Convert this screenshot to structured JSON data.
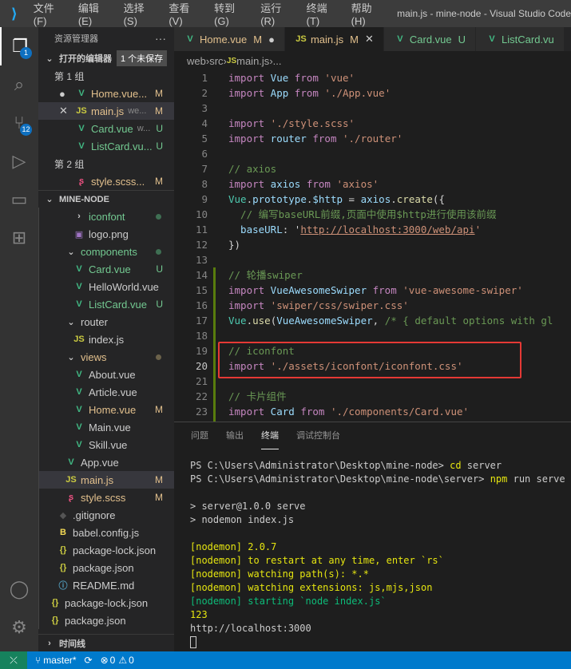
{
  "window": {
    "title": "main.js - mine-node - Visual Studio Code",
    "menu": [
      "文件(F)",
      "编辑(E)",
      "选择(S)",
      "查看(V)",
      "转到(G)",
      "运行(R)",
      "终端(T)",
      "帮助(H)"
    ]
  },
  "activity": [
    {
      "icon": "files-icon",
      "glyph": "❐",
      "badge": "1",
      "active": true
    },
    {
      "icon": "search-icon",
      "glyph": "⌕"
    },
    {
      "icon": "source-control-icon",
      "glyph": "⑂",
      "badge": "12"
    },
    {
      "icon": "run-debug-icon",
      "glyph": "▷"
    },
    {
      "icon": "remote-explorer-icon",
      "glyph": "▭"
    },
    {
      "icon": "extensions-icon",
      "glyph": "⊞"
    }
  ],
  "activity_bottom": [
    {
      "icon": "account-icon",
      "glyph": "◯"
    },
    {
      "icon": "settings-gear-icon",
      "glyph": "⚙"
    }
  ],
  "sidebar": {
    "title": "资源管理器",
    "more": "···",
    "open_editors": "打开的编辑器",
    "unsaved": "1 个未保存",
    "project": "MINE-NODE",
    "timeline": "时间线",
    "open_items": [
      {
        "type": "group",
        "label": "第 1 组"
      },
      {
        "label": "Home.vue...",
        "icon": "vue",
        "color": "#e2c08d",
        "status": "M",
        "lead": "●"
      },
      {
        "label": "main.js",
        "desc": "we...",
        "icon": "js",
        "color": "#e2c08d",
        "status": "M",
        "lead": "✕",
        "sel": true
      },
      {
        "label": "Card.vue",
        "desc": "w...",
        "icon": "vue",
        "color": "#73c991",
        "status": "U"
      },
      {
        "label": "ListCard.vu...",
        "icon": "vue",
        "color": "#73c991",
        "status": "U"
      },
      {
        "type": "group",
        "label": "第 2 组"
      },
      {
        "label": "style.scss...",
        "icon": "scss",
        "color": "#e2c08d",
        "status": "M"
      }
    ],
    "tree": [
      {
        "label": "iconfont",
        "indent": 3,
        "icon": "chev-r",
        "color": "#73c991",
        "dot": "#3f6f53"
      },
      {
        "label": "logo.png",
        "indent": 3,
        "icon": "img",
        "color": "#ccc"
      },
      {
        "label": "components",
        "indent": 2,
        "icon": "chev-d",
        "color": "#73c991",
        "dot": "#3f6f53"
      },
      {
        "label": "Card.vue",
        "indent": 3,
        "icon": "vue",
        "color": "#73c991",
        "status": "U"
      },
      {
        "label": "HelloWorld.vue",
        "indent": 3,
        "icon": "vue",
        "color": "#ccc"
      },
      {
        "label": "ListCard.vue",
        "indent": 3,
        "icon": "vue",
        "color": "#73c991",
        "status": "U"
      },
      {
        "label": "router",
        "indent": 2,
        "icon": "chev-d",
        "color": "#ccc"
      },
      {
        "label": "index.js",
        "indent": 3,
        "icon": "js",
        "color": "#ccc"
      },
      {
        "label": "views",
        "indent": 2,
        "icon": "chev-d",
        "color": "#e2c08d",
        "dot": "#6b624a"
      },
      {
        "label": "About.vue",
        "indent": 3,
        "icon": "vue",
        "color": "#ccc"
      },
      {
        "label": "Article.vue",
        "indent": 3,
        "icon": "vue",
        "color": "#ccc"
      },
      {
        "label": "Home.vue",
        "indent": 3,
        "icon": "vue",
        "color": "#e2c08d",
        "status": "M"
      },
      {
        "label": "Main.vue",
        "indent": 3,
        "icon": "vue",
        "color": "#ccc"
      },
      {
        "label": "Skill.vue",
        "indent": 3,
        "icon": "vue",
        "color": "#ccc"
      },
      {
        "label": "App.vue",
        "indent": 2,
        "icon": "vue",
        "color": "#ccc"
      },
      {
        "label": "main.js",
        "indent": 2,
        "icon": "js",
        "color": "#e2c08d",
        "status": "M",
        "sel": true
      },
      {
        "label": "style.scss",
        "indent": 2,
        "icon": "scss",
        "color": "#e2c08d",
        "status": "M"
      },
      {
        "label": ".gitignore",
        "indent": 1,
        "icon": "git",
        "color": "#ccc"
      },
      {
        "label": "babel.config.js",
        "indent": 1,
        "icon": "babel",
        "color": "#ccc"
      },
      {
        "label": "package-lock.json",
        "indent": 1,
        "icon": "json",
        "color": "#ccc"
      },
      {
        "label": "package.json",
        "indent": 1,
        "icon": "json",
        "color": "#ccc"
      },
      {
        "label": "README.md",
        "indent": 1,
        "icon": "info",
        "color": "#ccc"
      },
      {
        "label": "package-lock.json",
        "indent": 0,
        "icon": "json",
        "color": "#ccc"
      },
      {
        "label": "package.json",
        "indent": 0,
        "icon": "json",
        "color": "#ccc"
      }
    ]
  },
  "tabs": [
    {
      "label": "Home.vue",
      "status": "M",
      "icon": "vue",
      "color": "#e2c08d",
      "mark": "●"
    },
    {
      "label": "main.js",
      "status": "M",
      "icon": "js",
      "color": "#e2c08d",
      "mark": "✕",
      "active": true
    },
    {
      "label": "Card.vue",
      "status": "U",
      "icon": "vue",
      "color": "#73c991"
    },
    {
      "label": "ListCard.vu",
      "icon": "vue",
      "color": "#73c991"
    }
  ],
  "breadcrumb": [
    "web",
    "src",
    "main.js",
    "..."
  ],
  "code": [
    [
      [
        "import",
        "k"
      ],
      [
        " Vue ",
        "v"
      ],
      [
        "from",
        "k"
      ],
      [
        " 'vue'",
        "s"
      ]
    ],
    [
      [
        "import",
        "k"
      ],
      [
        " App ",
        "v"
      ],
      [
        "from",
        "k"
      ],
      [
        " './App.vue'",
        "s"
      ]
    ],
    [],
    [
      [
        "import",
        "k"
      ],
      [
        " './style.scss'",
        "s"
      ]
    ],
    [
      [
        "import",
        "k"
      ],
      [
        " router ",
        "v"
      ],
      [
        "from",
        "k"
      ],
      [
        " './router'",
        "s"
      ]
    ],
    [],
    [
      [
        "// axios",
        "c"
      ]
    ],
    [
      [
        "import",
        "k"
      ],
      [
        " axios ",
        "v"
      ],
      [
        "from",
        "k"
      ],
      [
        " 'axios'",
        "s"
      ]
    ],
    [
      [
        "Vue",
        "t"
      ],
      [
        ".",
        "p"
      ],
      [
        "prototype",
        "v"
      ],
      [
        ".",
        "p"
      ],
      [
        "$http",
        "v"
      ],
      [
        " = ",
        "p"
      ],
      [
        "axios",
        "v"
      ],
      [
        ".",
        "p"
      ],
      [
        "create",
        "f"
      ],
      [
        "({",
        "p"
      ]
    ],
    [
      [
        "  // 编写baseURL前缀,页面中使用$http进行使用该前缀",
        "c"
      ]
    ],
    [
      [
        "  baseURL",
        "v"
      ],
      [
        ": '",
        "p"
      ],
      [
        "http://localhost:3000/web/api",
        "u"
      ],
      [
        "'",
        "s"
      ]
    ],
    [
      [
        "})",
        "p"
      ]
    ],
    [],
    [
      [
        "// 轮播swiper",
        "c"
      ]
    ],
    [
      [
        "import",
        "k"
      ],
      [
        " VueAwesomeSwiper ",
        "v"
      ],
      [
        "from",
        "k"
      ],
      [
        " 'vue-awesome-swiper'",
        "s"
      ]
    ],
    [
      [
        "import",
        "k"
      ],
      [
        " 'swiper/css/swiper.css'",
        "s"
      ]
    ],
    [
      [
        "Vue",
        "t"
      ],
      [
        ".",
        "p"
      ],
      [
        "use",
        "f"
      ],
      [
        "(",
        "p"
      ],
      [
        "VueAwesomeSwiper",
        "v"
      ],
      [
        ", ",
        "p"
      ],
      [
        "/* { default options with gl",
        "c"
      ]
    ],
    [],
    [
      [
        "// iconfont",
        "c"
      ]
    ],
    [
      [
        "import",
        "k"
      ],
      [
        " './assets/iconfont/iconfont.css'",
        "s"
      ]
    ],
    [],
    [
      [
        "// 卡片组件",
        "c"
      ]
    ],
    [
      [
        "import",
        "k"
      ],
      [
        " Card ",
        "v"
      ],
      [
        "from",
        "k"
      ],
      [
        " './components/Card.vue'",
        "s"
      ]
    ]
  ],
  "current_line": 20,
  "panel": {
    "tabs": [
      "问题",
      "输出",
      "终端",
      "调试控制台"
    ],
    "active": 2,
    "terminal": [
      [
        [
          "PS C:\\Users\\Administrator\\Desktop\\mine-node> ",
          ""
        ],
        [
          "cd",
          "y"
        ],
        [
          " server",
          ""
        ]
      ],
      [
        [
          "PS C:\\Users\\Administrator\\Desktop\\mine-node\\server> ",
          ""
        ],
        [
          "npm",
          "y"
        ],
        [
          " run serve",
          ""
        ]
      ],
      [],
      [
        [
          "> server@1.0.0 serve",
          ""
        ]
      ],
      [
        [
          "> nodemon index.js",
          ""
        ]
      ],
      [],
      [
        [
          "[nodemon] 2.0.7",
          "y"
        ]
      ],
      [
        [
          "[nodemon] to restart at any time, enter `rs`",
          "y"
        ]
      ],
      [
        [
          "[nodemon] watching path(s): *.*",
          "y"
        ]
      ],
      [
        [
          "[nodemon] watching extensions: js,mjs,json",
          "y"
        ]
      ],
      [
        [
          "[nodemon] starting `node index.js`",
          "g"
        ]
      ],
      [
        [
          "123",
          "y"
        ]
      ],
      [
        [
          "http://localhost:3000",
          ""
        ]
      ]
    ]
  },
  "status": {
    "branch": "master*",
    "sync": "⟳",
    "errors": "0",
    "warnings": "0"
  }
}
